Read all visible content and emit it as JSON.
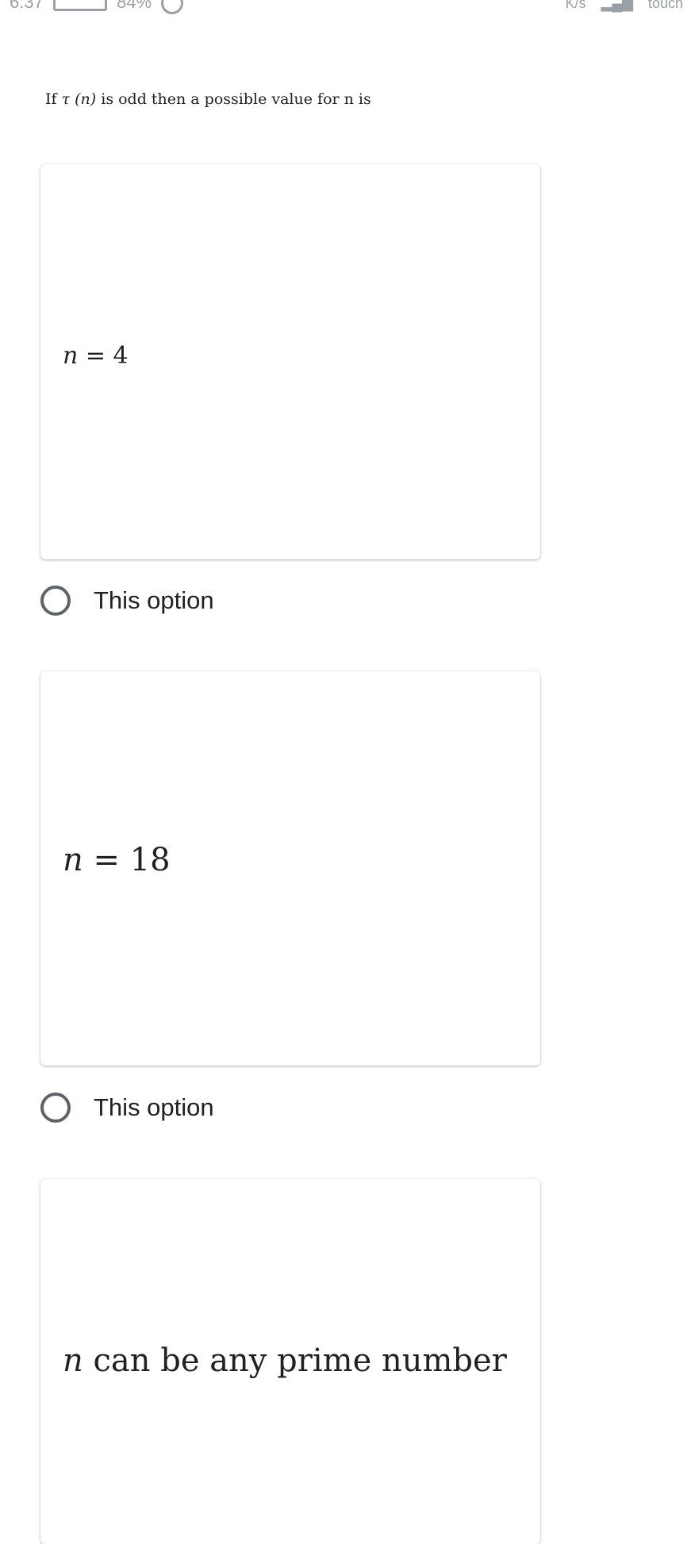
{
  "status_bar": {
    "left_text": "6:37",
    "battery_percent": "84%",
    "network_speed_unit": "K/s",
    "carrier_text": "touch"
  },
  "question": {
    "prefix": "If ",
    "symbol": "τ",
    "argument": "(n)",
    "suffix": " is odd then a possible value for n is"
  },
  "options": [
    {
      "var": "n",
      "rest": " = 4",
      "label": "This option"
    },
    {
      "var": "n",
      "rest": " = 18",
      "label": "This option"
    },
    {
      "var": "n",
      "rest": " can be any prime number"
    }
  ]
}
